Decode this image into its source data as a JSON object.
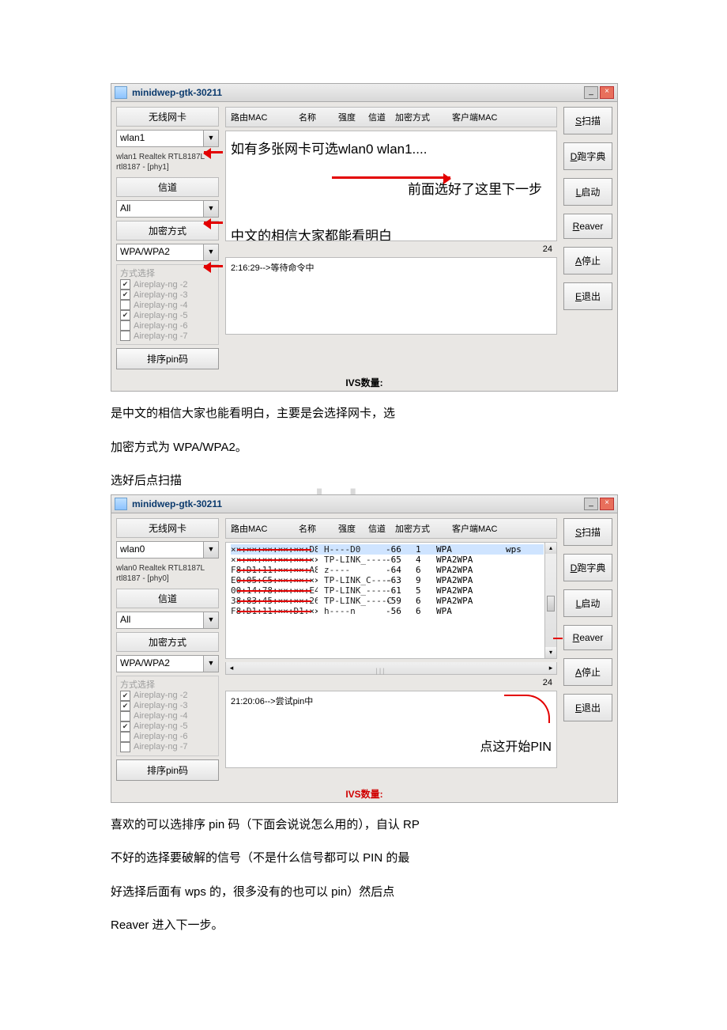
{
  "watermark": "www.bdocx.com",
  "app": {
    "title": "minidwep-gtk-30211",
    "left": {
      "card_label": "无线网卡",
      "channel_label": "信道",
      "encrypt_label": "加密方式",
      "method_title": "方式选择",
      "methods": [
        {
          "label": "Aireplay-ng -2",
          "checked": true
        },
        {
          "label": "Aireplay-ng -3",
          "checked": true
        },
        {
          "label": "Aireplay-ng -4",
          "checked": false
        },
        {
          "label": "Aireplay-ng -5",
          "checked": true
        },
        {
          "label": "Aireplay-ng -6",
          "checked": false
        },
        {
          "label": "Aireplay-ng -7",
          "checked": false
        }
      ],
      "sort_btn": "排序pin码"
    },
    "s1": {
      "card_val": "wlan1",
      "card_desc": "wlan1 Realtek RTL8187L rtl8187 - [phy1]",
      "channel_val": "All",
      "encrypt_val": "WPA/WPA2",
      "annot_card": "如有多张网卡可选wlan0 wlan1....",
      "annot_next": "前面选好了这里下一步",
      "annot_cn": "中文的相信大家都能看明白",
      "count": "24",
      "status_line": "2:16:29-->等待命令中"
    },
    "s2": {
      "card_val": "wlan0",
      "card_desc": "wlan0 Realtek RTL8187L rtl8187 - [phy0]",
      "channel_val": "All",
      "encrypt_val": "WPA/WPA2",
      "networks": [
        {
          "mac": "××:××:××:××:××:D8",
          "name": "H----D0",
          "pwr": "-66",
          "ch": "1",
          "enc": "WPA",
          "extra": "wps"
        },
        {
          "mac": "××:××:××:××:××:××",
          "name": "TP-LINK_----",
          "pwr": "-65",
          "ch": "4",
          "enc": "WPA2WPA",
          "extra": ""
        },
        {
          "mac": "F8:D1:11:××:××:A8",
          "name": "z----",
          "pwr": "-64",
          "ch": "6",
          "enc": "WPA2WPA",
          "extra": ""
        },
        {
          "mac": "E0:05:C5:××:××:××",
          "name": "TP-LINK_C----",
          "pwr": "-63",
          "ch": "9",
          "enc": "WPA2WPA",
          "extra": ""
        },
        {
          "mac": "00:14:78:××:××:E4",
          "name": "TP-LINK_----",
          "pwr": "-61",
          "ch": "5",
          "enc": "WPA2WPA",
          "extra": ""
        },
        {
          "mac": "38:83:45:××:××:26",
          "name": "TP-LINK_----C",
          "pwr": "-59",
          "ch": "6",
          "enc": "WPA2WPA",
          "extra": ""
        },
        {
          "mac": "F8:D1:11:××:D1:××",
          "name": "h----n",
          "pwr": "-56",
          "ch": "6",
          "enc": "WPA",
          "extra": ""
        }
      ],
      "annot_pin": "点这开始PIN",
      "count": "24",
      "status_line": "21:20:06-->尝试pin中"
    },
    "headers": {
      "mac": "路由MAC",
      "name": "名称",
      "power": "强度",
      "channel": "信道",
      "encrypt": "加密方式",
      "client": "客户端MAC"
    },
    "right": {
      "scan_u": "S",
      "scan": "扫描",
      "dict_u": "D",
      "dict": "跑字典",
      "start_u": "L",
      "start": "启动",
      "reaver_u": "R",
      "reaver": "eaver",
      "stop_u": "A",
      "stop": "停止",
      "exit_u": "E",
      "exit": "退出"
    },
    "ivs_label": "IVS数量:"
  },
  "paras": {
    "p1": "是中文的相信大家也能看明白，主要是会选择网卡，选",
    "p2": "加密方式为 WPA/WPA2。",
    "p3": "选好后点扫描",
    "q1": "喜欢的可以选排序 pin 码（下面会说说怎么用的），自认 RP",
    "q2": "不好的选择要破解的信号（不是什么信号都可以 PIN 的最",
    "q3": "好选择后面有 wps 的，很多没有的也可以 pin）然后点",
    "q4": "Reaver 进入下一步。"
  }
}
